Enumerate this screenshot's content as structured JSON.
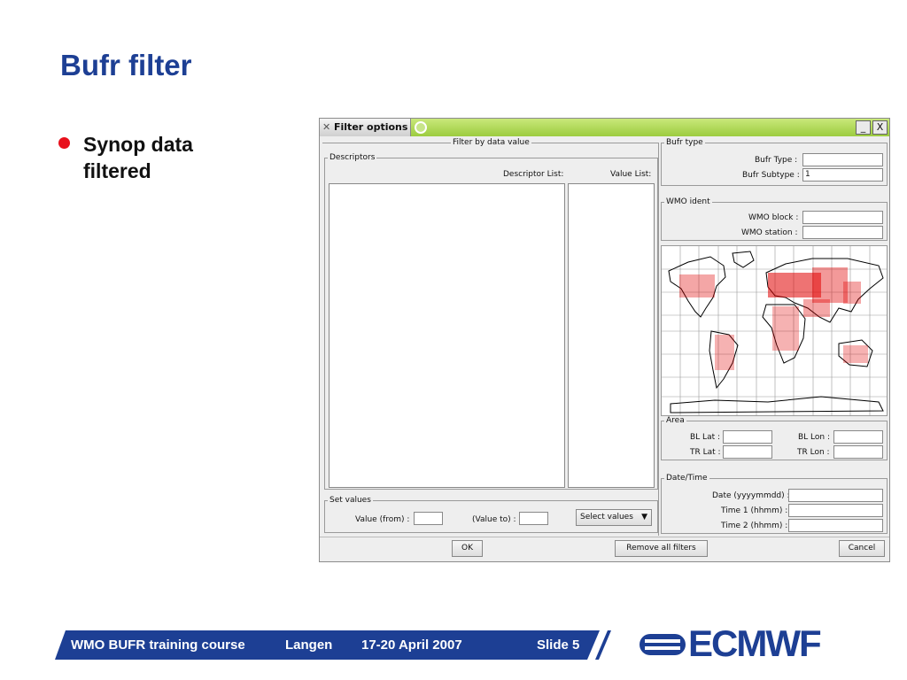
{
  "slide": {
    "title": "Bufr filter",
    "bullet": "Synop data filtered"
  },
  "window": {
    "title": "Filter options",
    "minimize": "_",
    "close": "X",
    "filter_by_value_legend": "Filter by data value",
    "descriptors": {
      "legend": "Descriptors",
      "descriptor_list_header": "Descriptor List:",
      "value_list_header": "Value List:"
    },
    "set_values": {
      "legend": "Set values",
      "value_from_label": "Value (from) :",
      "value_to_label": "(Value to) :",
      "value_from": "",
      "value_to": "",
      "select_values_label": "Select values"
    },
    "bufr_type": {
      "legend": "Bufr type",
      "bufr_type_label": "Bufr Type :",
      "bufr_type_value": "",
      "bufr_subtype_label": "Bufr Subtype :",
      "bufr_subtype_value": "1"
    },
    "wmo_ident": {
      "legend": "WMO ident",
      "wmo_block_label": "WMO block :",
      "wmo_block_value": "",
      "wmo_station_label": "WMO station :",
      "wmo_station_value": ""
    },
    "area": {
      "legend": "Area",
      "bl_lat_label": "BL Lat :",
      "bl_lon_label": "BL Lon :",
      "tr_lat_label": "TR Lat :",
      "tr_lon_label": "TR Lon :",
      "bl_lat": "",
      "bl_lon": "",
      "tr_lat": "",
      "tr_lon": ""
    },
    "date_time": {
      "legend": "Date/Time",
      "date_label": "Date (yyyymmdd) :",
      "time1_label": "Time 1 (hhmm) :",
      "time2_label": "Time 2 (hhmm) :",
      "date": "",
      "time1": "",
      "time2": ""
    },
    "buttons": {
      "ok": "OK",
      "remove_all": "Remove all filters",
      "cancel": "Cancel"
    }
  },
  "footer": {
    "course": "WMO BUFR training course",
    "place": "Langen",
    "dates": "17-20 April 2007",
    "slide": "Slide 5",
    "logo": "ECMWF"
  },
  "colors": {
    "title_blue": "#1d3f94",
    "bullet_red": "#e8101c",
    "footer_blue": "#1d3f94",
    "titlebar_green": "#9ccc3f",
    "station_red": "#e00000"
  }
}
